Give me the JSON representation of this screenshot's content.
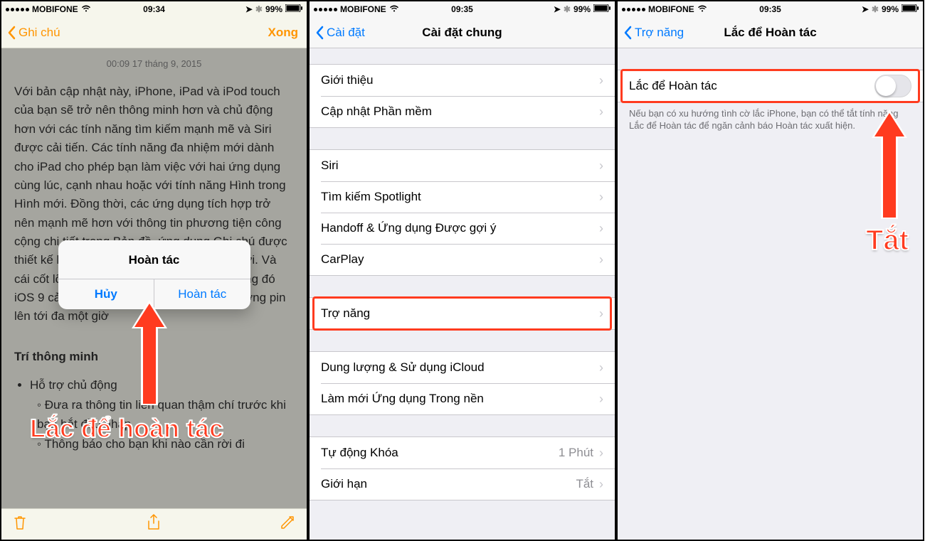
{
  "status": {
    "carrier": "MOBIFONE",
    "battery": "99%"
  },
  "phone1": {
    "time": "09:34",
    "nav_back": "Ghi chú",
    "nav_done": "Xong",
    "note_date": "00:09 17 tháng 9, 2015",
    "para": "Với bản cập nhật này, iPhone, iPad và iPod touch của bạn sẽ trở nên thông minh hơn và chủ động hơn với các tính năng tìm kiếm mạnh mẽ và Siri được cải tiến. Các tính năng đa nhiệm mới dành cho iPad cho phép bạn làm việc với hai ứng dụng cùng lúc, cạnh nhau hoặc với tính năng Hình trong Hình mới. Đồng thời, các ứng dụng tích hợp trở nên mạnh mẽ hơn với thông tin phương tiện công cộng chi tiết trong Bản đồ, ứng dụng Ghi chú được thiết kế lại và ứng dụng News hoàn toàn mới. Và cái cốt lõi là nền tảng của hệ điều hành, trong đó iOS 9 cải thiện tính bảo mật và tăng thời lượng pin lên tới đa một giờ",
    "heading": "Trí thông minh",
    "bullets": [
      "Hỗ trợ chủ động",
      "Đưa ra thông tin liên quan thậm chí trước khi bạn bắt đầu nhập",
      "Thông báo cho bạn khi nào cần rời đi"
    ],
    "alert_title": "Hoàn tác",
    "alert_cancel": "Hủy",
    "alert_undo": "Hoàn tác",
    "annotation": "Lắc để hoàn tác"
  },
  "phone2": {
    "time": "09:35",
    "nav_back": "Cài đặt",
    "title": "Cài đặt chung",
    "groups": [
      [
        "Giới thiệu",
        "Cập nhật Phần mềm"
      ],
      [
        "Siri",
        "Tìm kiếm Spotlight",
        "Handoff & Ứng dụng Được gợi ý",
        "CarPlay"
      ],
      [
        "Trợ năng"
      ],
      [
        "Dung lượng & Sử dụng iCloud",
        "Làm mới Ứng dụng Trong nền"
      ]
    ],
    "last_group": {
      "auto_lock": "Tự động Khóa",
      "auto_lock_value": "1 Phút",
      "restrictions": "Giới hạn",
      "restrictions_value": "Tắt"
    }
  },
  "phone3": {
    "time": "09:35",
    "nav_back": "Trợ năng",
    "title": "Lắc để Hoàn tác",
    "row_label": "Lắc để Hoàn tác",
    "footer": "Nếu bạn có xu hướng tình cờ lắc iPhone, bạn có thể tắt tính năng Lắc để Hoàn tác để ngăn cảnh báo Hoàn tác xuất hiện.",
    "annotation": "Tắt"
  }
}
